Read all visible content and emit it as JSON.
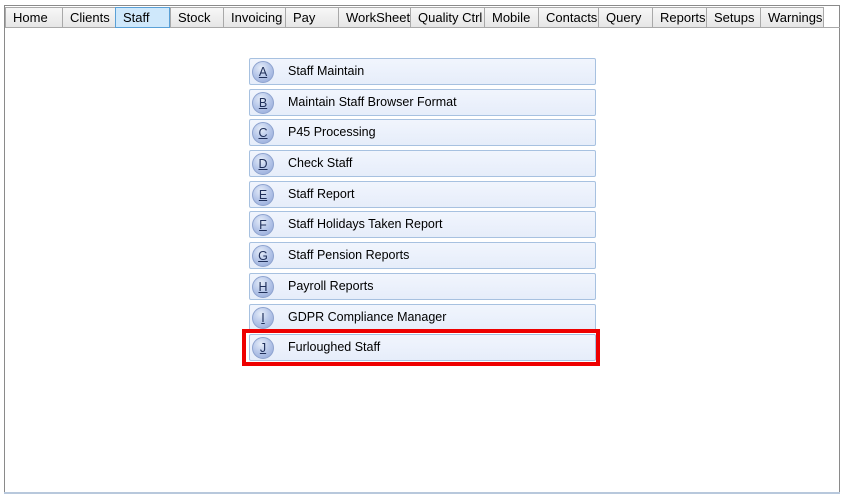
{
  "tabs": [
    {
      "label": "Home",
      "width": 57
    },
    {
      "label": "Clients",
      "width": 53
    },
    {
      "label": "Staff",
      "width": 55,
      "active": true
    },
    {
      "label": "Stock",
      "width": 53
    },
    {
      "label": "Invoicing",
      "width": 62
    },
    {
      "label": "Pay",
      "width": 53
    },
    {
      "label": "WorkSheet",
      "width": 72
    },
    {
      "label": "Quality Ctrl",
      "width": 74
    },
    {
      "label": "Mobile",
      "width": 54
    },
    {
      "label": "Contacts",
      "width": 60
    },
    {
      "label": "Query",
      "width": 54
    },
    {
      "label": "Reports",
      "width": 54
    },
    {
      "label": "Setups",
      "width": 54
    },
    {
      "label": "Warnings",
      "width": 64
    }
  ],
  "menu": {
    "items": [
      {
        "key": "A",
        "label": "Staff Maintain"
      },
      {
        "key": "B",
        "label": "Maintain Staff Browser Format"
      },
      {
        "key": "C",
        "label": "P45 Processing"
      },
      {
        "key": "D",
        "label": "Check Staff"
      },
      {
        "key": "E",
        "label": "Staff Report"
      },
      {
        "key": "F",
        "label": "Staff Holidays Taken Report"
      },
      {
        "key": "G",
        "label": "Staff Pension Reports"
      },
      {
        "key": "H",
        "label": "Payroll Reports"
      },
      {
        "key": "I",
        "label": "GDPR Compliance Manager"
      },
      {
        "key": "J",
        "label": "Furloughed Staff"
      }
    ]
  },
  "colors": {
    "highlight": "#ee0000",
    "active_tab": "#cfe8fb",
    "menu_button": "#e9effb"
  }
}
